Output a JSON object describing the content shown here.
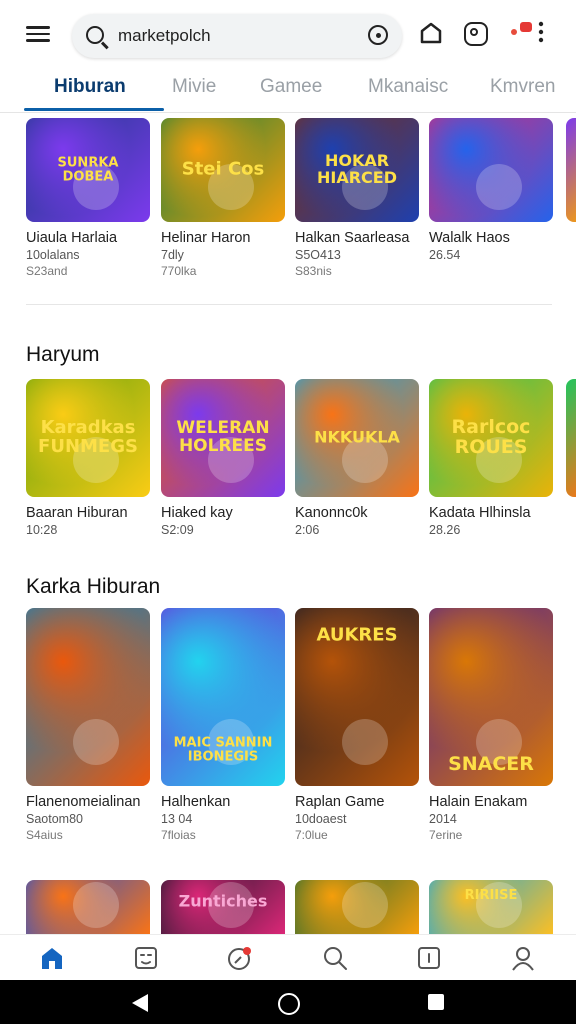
{
  "search": {
    "query": "marketpolch"
  },
  "tabs": [
    {
      "label": "Hiburan",
      "active": true
    },
    {
      "label": "Mivie"
    },
    {
      "label": "Gamee"
    },
    {
      "label": "Mkanaisc"
    },
    {
      "label": "Kmvren"
    }
  ],
  "sections": [
    {
      "title": "",
      "cards": [
        {
          "art": "SUNRKA DOBEA",
          "title": "Uiaula Harlaia",
          "sub": "10olalans",
          "meta": "S23and",
          "colors": [
            "#1e3a8a",
            "#7c3aed"
          ]
        },
        {
          "art": "Stei Cos",
          "title": "Helinar Haron",
          "sub": "7dly",
          "meta": "770lka",
          "colors": [
            "#15803d",
            "#f59e0b"
          ]
        },
        {
          "art": "HOKAR HIARCED",
          "title": "Halkan Saarleasa",
          "sub": "S5O413",
          "meta": "S83nis",
          "colors": [
            "#7c2d12",
            "#1e40af"
          ]
        },
        {
          "art": "",
          "title": "Walalk Haos",
          "sub": "26.54",
          "meta": "",
          "colors": [
            "#db2777",
            "#2563eb"
          ]
        }
      ]
    },
    {
      "title": "Haryum",
      "cards": [
        {
          "art": "Karadkas FUNMEGS",
          "title": "Baaran Hiburan",
          "sub": "10:28",
          "meta": "",
          "colors": [
            "#65a30d",
            "#facc15"
          ]
        },
        {
          "art": "WELERAN HOLREES",
          "title": "Hiaked kay",
          "sub": "S2:09",
          "meta": "",
          "colors": [
            "#ea580c",
            "#7c3aed"
          ]
        },
        {
          "art": "NKKUKLA",
          "title": "Kanonnc0k",
          "sub": "2:06",
          "meta": "",
          "colors": [
            "#0ea5e9",
            "#f97316"
          ]
        },
        {
          "art": "Rarlcoc ROUES",
          "title": "Kadata Hlhinsla",
          "sub": "28.26",
          "meta": "",
          "colors": [
            "#22c55e",
            "#eab308"
          ]
        }
      ]
    },
    {
      "title": "Karka Hiburan",
      "cards": [
        {
          "art": "",
          "title": "Flanenomeialinan",
          "sub": "Saotom80",
          "meta": "S4aius",
          "colors": [
            "#0284c7",
            "#ea580c"
          ]
        },
        {
          "art": "MAIC SANNIN IBONEGIS",
          "title": "Halhenkan",
          "sub": "13 04",
          "meta": "7floias",
          "colors": [
            "#6d28d9",
            "#22d3ee"
          ]
        },
        {
          "art": "AUKRES",
          "title": "Raplan Game",
          "sub": "10doaest",
          "meta": "7:0lue",
          "colors": [
            "#0f172a",
            "#b45309"
          ]
        },
        {
          "art": "SNACER",
          "title": "Halain Enakam",
          "sub": "2014",
          "meta": "7erine",
          "colors": [
            "#4c1d95",
            "#d97706"
          ]
        }
      ]
    },
    {
      "title": "",
      "cards": [
        {
          "art": "",
          "colors": [
            "#1d4ed8",
            "#f97316"
          ]
        },
        {
          "art": "Zuntiches",
          "colors": [
            "#111827",
            "#db2777"
          ]
        },
        {
          "art": "",
          "colors": [
            "#166534",
            "#f59e0b"
          ]
        },
        {
          "art": "RIRIISE",
          "colors": [
            "#0ea5e9",
            "#fbbf24"
          ]
        }
      ]
    }
  ],
  "nav": [
    "home-icon",
    "smiley-icon",
    "explore-icon",
    "search-icon",
    "library-icon",
    "profile-icon"
  ]
}
